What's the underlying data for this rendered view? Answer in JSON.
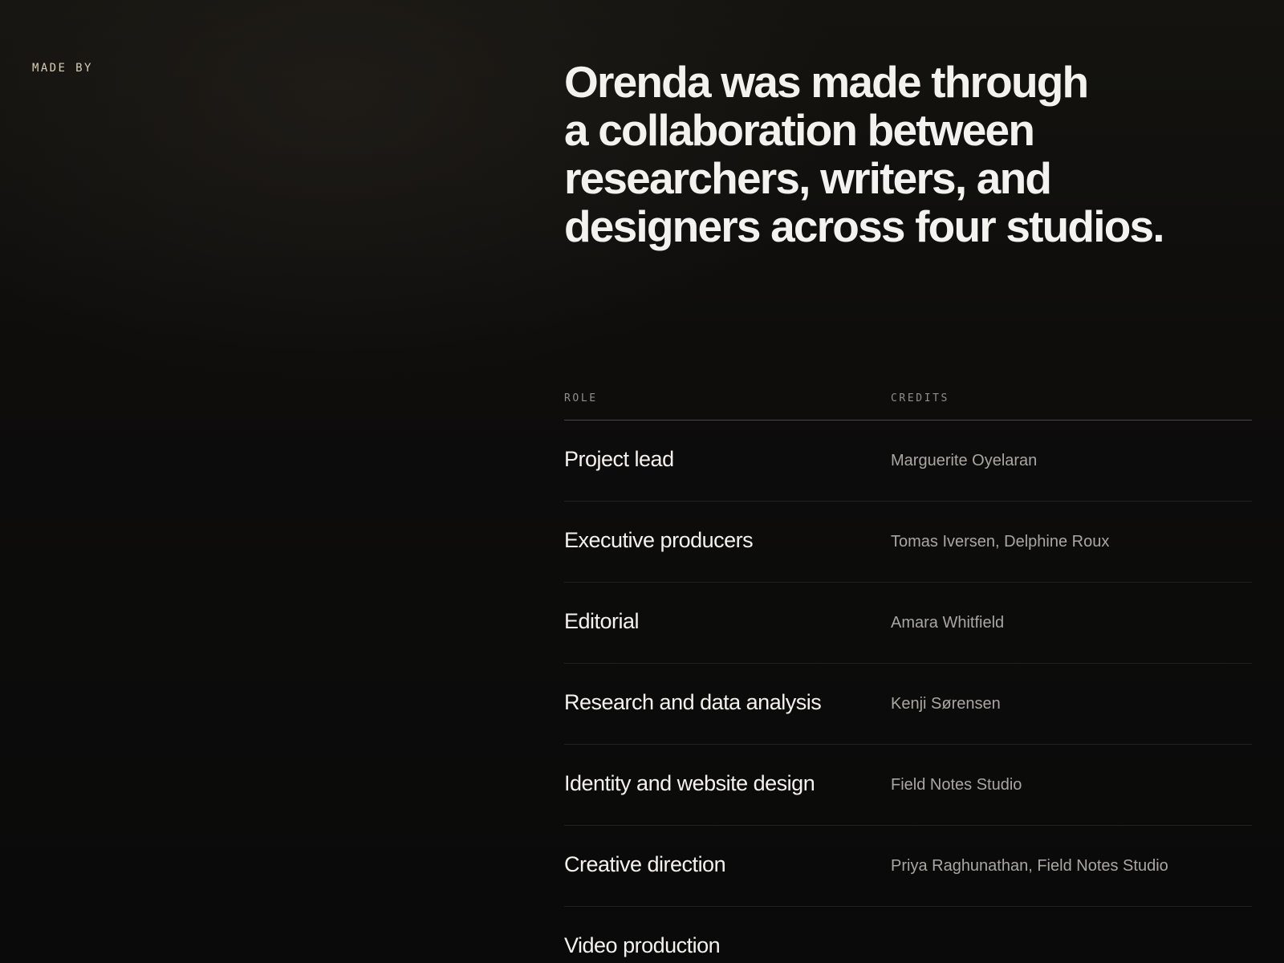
{
  "section": {
    "eyebrow": "MADE BY",
    "headline_lines": [
      "Orenda was made through",
      "a collaboration between",
      "researchers, writers, and",
      "designers across four studios."
    ]
  },
  "credits_table": {
    "headers": {
      "role": "ROLE",
      "credits": "CREDITS"
    },
    "rows": [
      {
        "role": "Project lead",
        "credit": "Marguerite Oyelaran"
      },
      {
        "role": "Executive producers",
        "credit": "Tomas Iversen, Delphine Roux"
      },
      {
        "role": "Editorial",
        "credit": "Amara Whitfield"
      },
      {
        "role": "Research and data analysis",
        "credit": "Kenji Sørensen"
      },
      {
        "role": "Identity and website design",
        "credit": "Field Notes Studio"
      },
      {
        "role": "Creative direction",
        "credit": "Priya Raghunathan, Field Notes Studio"
      },
      {
        "role": "Video production",
        "credit": ""
      }
    ]
  },
  "colors": {
    "background": "#0b0b0b",
    "headline": "#f4f2ee",
    "eyebrow": "#d8cfb8",
    "credit_text": "#a9a7a2",
    "header_text": "#8f8f8f"
  }
}
